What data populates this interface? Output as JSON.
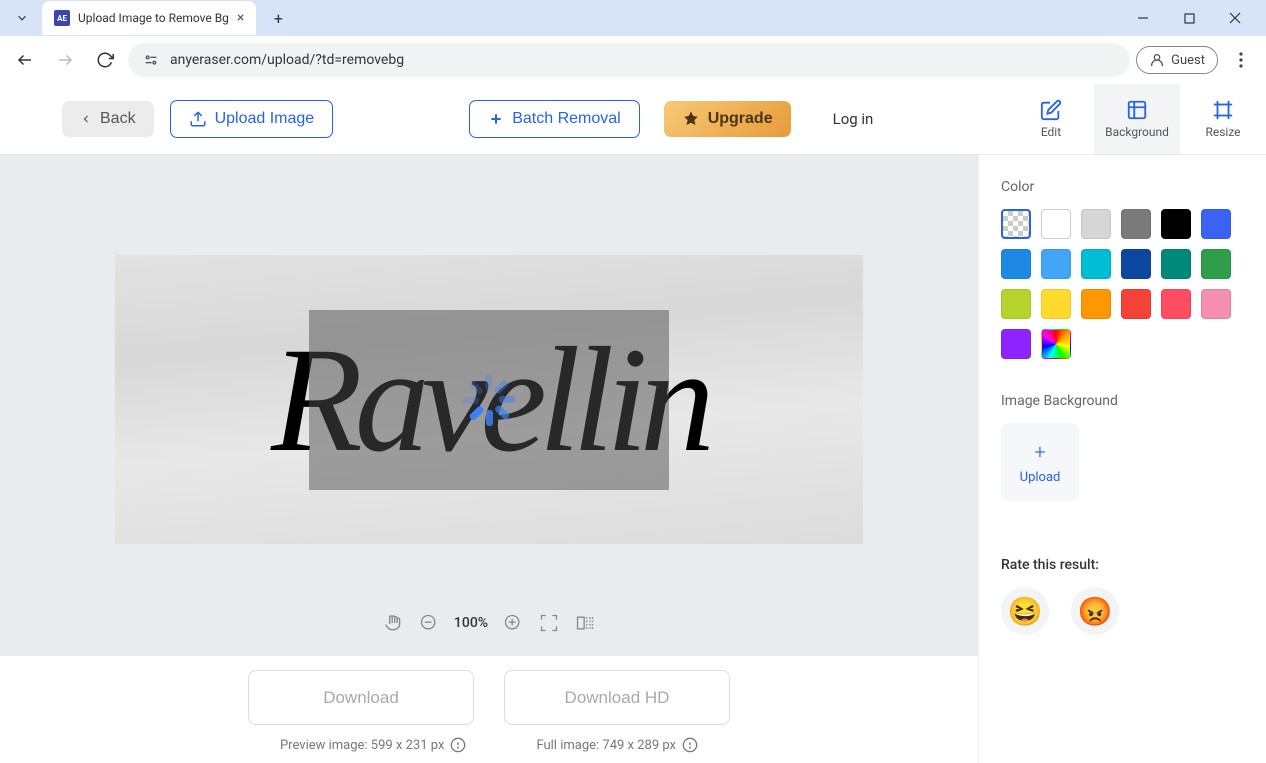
{
  "browser": {
    "tab_title": "Upload Image to Remove Bg",
    "favicon_text": "AE",
    "url": "anyeraser.com/upload/?td=removebg",
    "guest_label": "Guest"
  },
  "header": {
    "back": "Back",
    "upload_image": "Upload Image",
    "batch_removal": "Batch Removal",
    "upgrade": "Upgrade",
    "login": "Log in",
    "tools": {
      "edit": "Edit",
      "background": "Background",
      "resize": "Resize"
    }
  },
  "canvas": {
    "signature_text": "Ravellin",
    "zoom_pct": "100%"
  },
  "downloads": {
    "download": "Download",
    "download_hd": "Download HD",
    "preview_meta": "Preview image: 599 x 231 px",
    "full_meta": "Full image: 749 x 289 px"
  },
  "sidebar": {
    "color_label": "Color",
    "colors": [
      {
        "name": "transparent",
        "css_class": "transparent"
      },
      {
        "name": "white",
        "css_class": "white"
      },
      {
        "name": "light-gray",
        "css": "#d6d6d6"
      },
      {
        "name": "gray",
        "css": "#7a7a7a"
      },
      {
        "name": "black",
        "css": "#000000"
      },
      {
        "name": "blue",
        "css": "#3b63f3"
      },
      {
        "name": "sky-blue",
        "css": "#1e88e5"
      },
      {
        "name": "light-blue",
        "css": "#42a5f5"
      },
      {
        "name": "teal",
        "css": "#00bcd4"
      },
      {
        "name": "navy",
        "css": "#0d47a1"
      },
      {
        "name": "green",
        "css": "#00897b"
      },
      {
        "name": "emerald",
        "css": "#2e9e4b"
      },
      {
        "name": "lime",
        "css": "#b6d52c"
      },
      {
        "name": "yellow",
        "css": "#ffd92e"
      },
      {
        "name": "orange",
        "css": "#ff9800"
      },
      {
        "name": "red",
        "css": "#f44336"
      },
      {
        "name": "pink-red",
        "css": "#ff4d62"
      },
      {
        "name": "pink",
        "css": "#f48fb1"
      },
      {
        "name": "purple",
        "css": "#8e24ff"
      },
      {
        "name": "rainbow",
        "css_class": "rainbow"
      }
    ],
    "image_bg_label": "Image Background",
    "upload_label": "Upload",
    "rate_label": "Rate this result:",
    "emoji_happy": "😆",
    "emoji_angry": "😡"
  }
}
